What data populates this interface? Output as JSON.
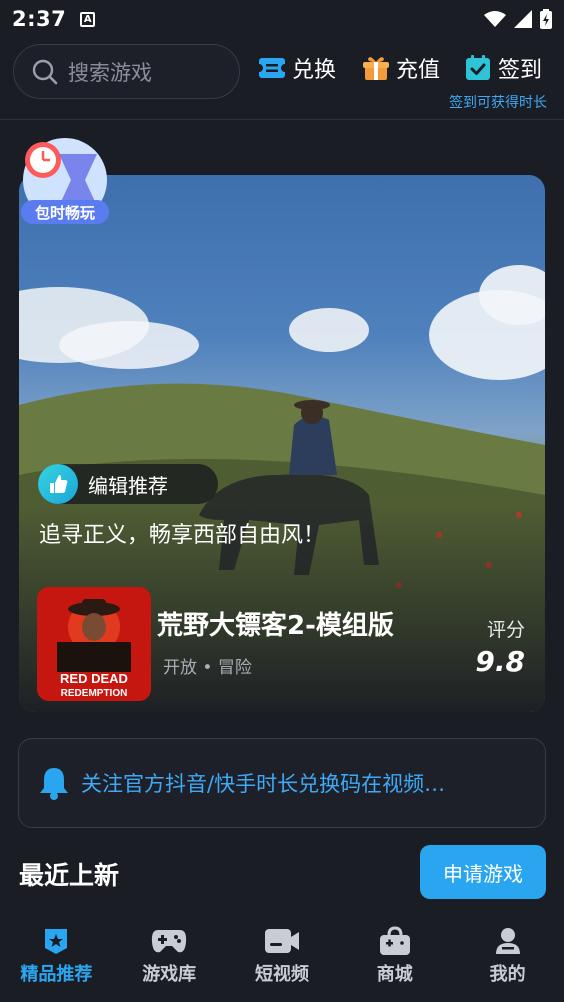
{
  "status_bar": {
    "time": "2:37",
    "notification_glyph": "A"
  },
  "header": {
    "search": {
      "placeholder": "搜索游戏"
    },
    "actions": [
      {
        "label": "兑换",
        "icon": "ticket-icon",
        "color": "#2aa6f0"
      },
      {
        "label": "充值",
        "icon": "gift-icon",
        "color": "#f39a3b"
      },
      {
        "label": "签到",
        "icon": "calendar-check-icon",
        "color": "#2ec4d8"
      }
    ],
    "checkin_hint": "签到可获得时长"
  },
  "hero": {
    "time_badge": "包时畅玩",
    "tag": "编辑推荐",
    "slogan": "追寻正义，畅享西部自由风！",
    "game": {
      "title": "荒野大镖客2-模组版",
      "tags": "开放 • 冒险",
      "cover_text_line1": "RED DEAD",
      "cover_text_line2": "REDEMPTION",
      "score_label": "评分",
      "score": "9.8"
    }
  },
  "notice": {
    "text": "关注官方抖音/快手时长兑换码在视频…"
  },
  "section": {
    "title": "最近上新",
    "apply_label": "申请游戏"
  },
  "bottom_nav": [
    {
      "label": "精品推荐",
      "icon": "star-badge-icon",
      "active": true
    },
    {
      "label": "游戏库",
      "icon": "gamepad-icon",
      "active": false
    },
    {
      "label": "短视频",
      "icon": "video-camera-icon",
      "active": false
    },
    {
      "label": "商城",
      "icon": "shop-bag-icon",
      "active": false
    },
    {
      "label": "我的",
      "icon": "person-icon",
      "active": false
    }
  ],
  "colors": {
    "accent": "#2aa6f0",
    "background": "#1a1d24"
  }
}
